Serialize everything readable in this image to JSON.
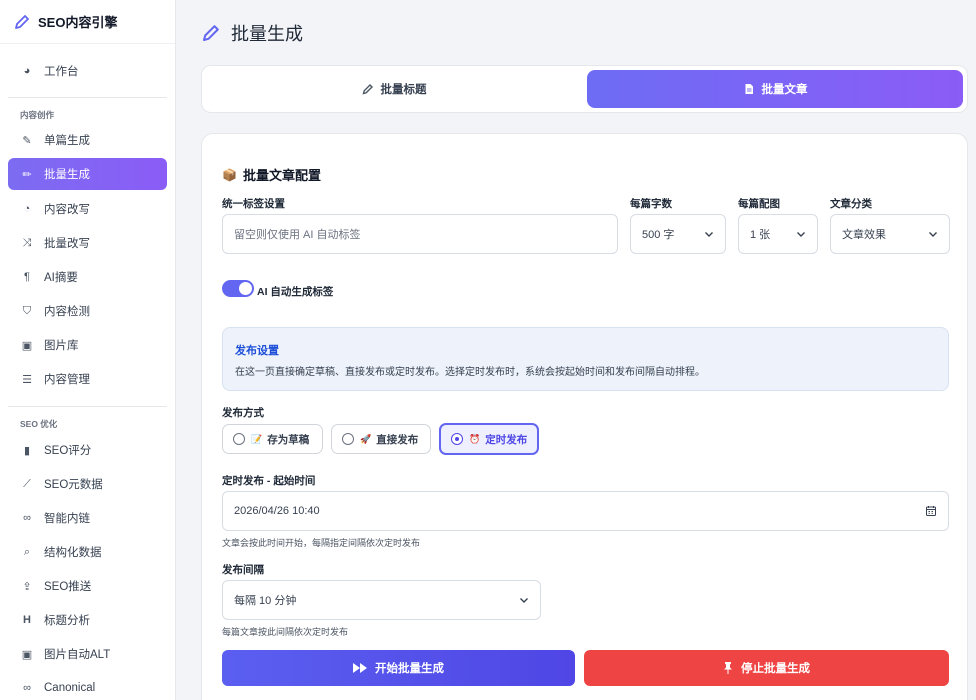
{
  "brand": {
    "title": "SEO内容引擎"
  },
  "sidebar": {
    "dashboard": "工作台",
    "section_content": "内容创作",
    "content_items": [
      "单篇生成",
      "批量生成",
      "内容改写",
      "批量改写",
      "AI摘要",
      "内容检测",
      "图片库",
      "内容管理"
    ],
    "section_seo": "SEO 优化",
    "seo_items": [
      "SEO评分",
      "SEO元数据",
      "智能内链",
      "结构化数据",
      "SEO推送",
      "标题分析",
      "图片自动ALT",
      "Canonical"
    ],
    "active_item": "批量生成"
  },
  "page": {
    "title": "批量生成"
  },
  "tabs": [
    {
      "label": "批量标题",
      "active": false
    },
    {
      "label": "批量文章",
      "active": true
    }
  ],
  "config": {
    "title": "批量文章配置",
    "tags_label": "统一标签设置",
    "tags_placeholder": "留空则仅使用 AI 自动标签",
    "words_label": "每篇字数",
    "words_value": "500 字",
    "images_label": "每篇配图",
    "images_value": "1 张",
    "category_label": "文章分类",
    "category_value": "文章效果",
    "auto_tag_label": "AI 自动生成标签",
    "auto_tag_on": true
  },
  "publish_info": {
    "title": "发布设置",
    "text": "在这一页直接确定草稿、直接发布或定时发布。选择定时发布时，系统会按起始时间和发布间隔自动排程。"
  },
  "publish_mode": {
    "label": "发布方式",
    "options": [
      "存为草稿",
      "直接发布",
      "定时发布"
    ],
    "selected": "定时发布"
  },
  "schedule": {
    "label": "定时发布 - 起始时间",
    "value": "2026/04/26 10:40",
    "hint": "文章会按此时间开始，每隔指定间隔依次定时发布"
  },
  "interval": {
    "label": "发布间隔",
    "value": "每隔 10 分钟",
    "hint": "每篇文章按此间隔依次定时发布"
  },
  "actions": {
    "start": "开始批量生成",
    "stop": "停止批量生成"
  },
  "colors": {
    "accent": "#6366f1",
    "danger": "#ef4444",
    "info_title": "#1d4ed8"
  }
}
